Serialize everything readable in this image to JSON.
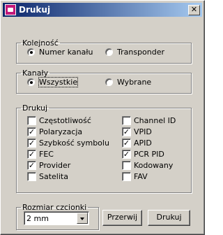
{
  "window": {
    "title": "Drukuj",
    "close_symbol": "✕"
  },
  "kolejnosc": {
    "legend": "Kolejność",
    "options": [
      {
        "label": "Numer kanału",
        "selected": true
      },
      {
        "label": "Transponder",
        "selected": false
      }
    ]
  },
  "kanaly": {
    "legend": "Kanały",
    "options": [
      {
        "label": "Wszystkie",
        "selected": true
      },
      {
        "label": "Wybrane",
        "selected": false
      }
    ]
  },
  "drukuj": {
    "legend": "Drukuj",
    "left": [
      {
        "label": "Częstotliwość",
        "checked": false
      },
      {
        "label": "Polaryzacja",
        "checked": true
      },
      {
        "label": "Szybkość symbolu",
        "checked": true
      },
      {
        "label": "FEC",
        "checked": true
      },
      {
        "label": "Provider",
        "checked": true
      },
      {
        "label": "Satelita",
        "checked": false
      }
    ],
    "right": [
      {
        "label": "Channel ID",
        "checked": false
      },
      {
        "label": "VPID",
        "checked": true
      },
      {
        "label": "APID",
        "checked": true
      },
      {
        "label": "PCR PID",
        "checked": true
      },
      {
        "label": "Kodowany",
        "checked": false
      },
      {
        "label": "FAV",
        "checked": false
      }
    ]
  },
  "font_size": {
    "legend": "Rozmiar czcionki",
    "value": "2 mm"
  },
  "buttons": {
    "cancel": "Przerwij",
    "print": "Drukuj"
  },
  "check_mark": "✓"
}
